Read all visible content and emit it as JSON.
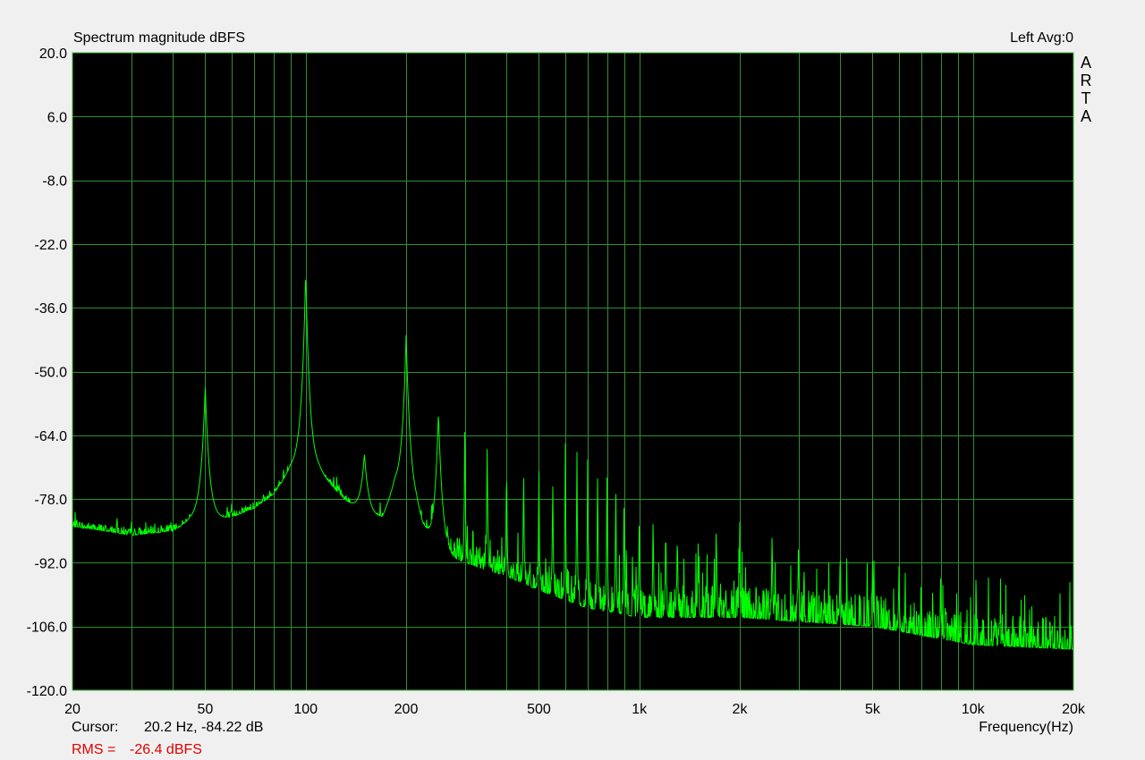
{
  "header": {
    "title": "Spectrum magnitude dBFS",
    "status": "Left  Avg:0",
    "logo_letters": [
      "A",
      "R",
      "T",
      "A"
    ]
  },
  "footer": {
    "cursor_label": "Cursor:",
    "cursor_value": "20.2 Hz, -84.22 dB",
    "rms_label": "RMS =",
    "rms_value": "-26.4 dBFS"
  },
  "colors": {
    "background": "#000000",
    "grid": "#2f8f2f",
    "frame": "#3fbf3f",
    "trace": "#00ff00",
    "window": "#f0f0f0",
    "rms": "#e00000"
  },
  "chart_data": {
    "type": "line",
    "title": "Spectrum magnitude dBFS",
    "xlabel": "Frequency(Hz)",
    "ylabel": "",
    "x_scale": "log",
    "xlim": [
      20,
      20000
    ],
    "ylim": [
      -120,
      20
    ],
    "grid": true,
    "x_tick_labels": [
      {
        "value": 20,
        "label": "20"
      },
      {
        "value": 50,
        "label": "50"
      },
      {
        "value": 100,
        "label": "100"
      },
      {
        "value": 200,
        "label": "200"
      },
      {
        "value": 500,
        "label": "500"
      },
      {
        "value": 1000,
        "label": "1k"
      },
      {
        "value": 2000,
        "label": "2k"
      },
      {
        "value": 5000,
        "label": "5k"
      },
      {
        "value": 10000,
        "label": "10k"
      },
      {
        "value": 20000,
        "label": "20k"
      }
    ],
    "y_tick_labels": [
      {
        "value": 20,
        "label": "20.0"
      },
      {
        "value": 6,
        "label": "6.0"
      },
      {
        "value": -8,
        "label": "-8.0"
      },
      {
        "value": -22,
        "label": "-22.0"
      },
      {
        "value": -36,
        "label": "-36.0"
      },
      {
        "value": -50,
        "label": "-50.0"
      },
      {
        "value": -64,
        "label": "-64.0"
      },
      {
        "value": -78,
        "label": "-78.0"
      },
      {
        "value": -92,
        "label": "-92.0"
      },
      {
        "value": -106,
        "label": "-106.0"
      },
      {
        "value": -120,
        "label": "-120.0"
      }
    ],
    "series": [
      {
        "peaks": [
          {
            "x": 50,
            "y": -53
          },
          {
            "x": 100,
            "y": -28
          },
          {
            "x": 150,
            "y": -68
          },
          {
            "x": 200,
            "y": -42
          },
          {
            "x": 250,
            "y": -59
          },
          {
            "x": 300,
            "y": -54
          },
          {
            "x": 350,
            "y": -60
          },
          {
            "x": 400,
            "y": -66
          },
          {
            "x": 450,
            "y": -68
          },
          {
            "x": 500,
            "y": -69
          },
          {
            "x": 550,
            "y": -70
          },
          {
            "x": 600,
            "y": -64
          },
          {
            "x": 650,
            "y": -64
          },
          {
            "x": 700,
            "y": -66
          },
          {
            "x": 750,
            "y": -68
          },
          {
            "x": 800,
            "y": -70
          },
          {
            "x": 850,
            "y": -72
          },
          {
            "x": 900,
            "y": -74
          },
          {
            "x": 1000,
            "y": -76
          },
          {
            "x": 1100,
            "y": -78
          },
          {
            "x": 1200,
            "y": -80
          },
          {
            "x": 1300,
            "y": -82
          },
          {
            "x": 1500,
            "y": -85
          },
          {
            "x": 1700,
            "y": -80
          },
          {
            "x": 2000,
            "y": -83
          },
          {
            "x": 2500,
            "y": -82
          },
          {
            "x": 3000,
            "y": -84
          },
          {
            "x": 4000,
            "y": -86
          },
          {
            "x": 5000,
            "y": -90
          },
          {
            "x": 6000,
            "y": -92
          },
          {
            "x": 8000,
            "y": -94
          },
          {
            "x": 12000,
            "y": -103
          }
        ],
        "floor": [
          {
            "x": 20,
            "y": -84
          },
          {
            "x": 25,
            "y": -85
          },
          {
            "x": 30,
            "y": -86
          },
          {
            "x": 40,
            "y": -85
          },
          {
            "x": 45,
            "y": -83
          },
          {
            "x": 60,
            "y": -82
          },
          {
            "x": 70,
            "y": -80
          },
          {
            "x": 80,
            "y": -77
          },
          {
            "x": 90,
            "y": -72
          },
          {
            "x": 110,
            "y": -72
          },
          {
            "x": 130,
            "y": -78
          },
          {
            "x": 150,
            "y": -82
          },
          {
            "x": 170,
            "y": -82
          },
          {
            "x": 185,
            "y": -76
          },
          {
            "x": 215,
            "y": -80
          },
          {
            "x": 240,
            "y": -90
          },
          {
            "x": 300,
            "y": -92
          },
          {
            "x": 400,
            "y": -95
          },
          {
            "x": 500,
            "y": -98
          },
          {
            "x": 700,
            "y": -102
          },
          {
            "x": 1000,
            "y": -104
          },
          {
            "x": 2000,
            "y": -104
          },
          {
            "x": 5000,
            "y": -106
          },
          {
            "x": 10000,
            "y": -110
          },
          {
            "x": 20000,
            "y": -111
          }
        ]
      }
    ]
  }
}
